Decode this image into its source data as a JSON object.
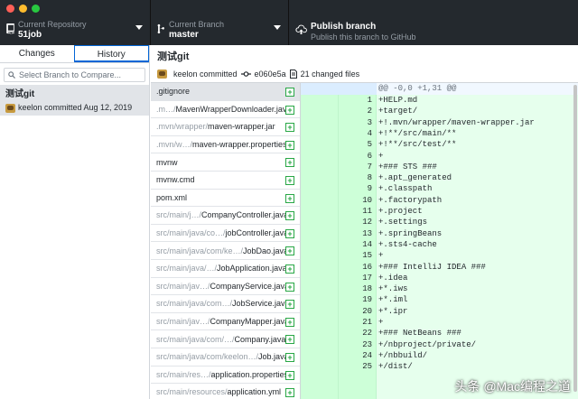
{
  "toolbar": {
    "repo_label": "Current Repository",
    "repo_value": "51job",
    "branch_label": "Current Branch",
    "branch_value": "master",
    "publish_title": "Publish branch",
    "publish_subtitle": "Publish this branch to GitHub"
  },
  "sidebar": {
    "tabs": [
      {
        "label": "Changes"
      },
      {
        "label": "History"
      }
    ],
    "active_tab": "History",
    "filter_placeholder": "Select Branch to Compare...",
    "commit": {
      "title": "测试git",
      "meta": "keelon committed Aug 12, 2019"
    }
  },
  "commit_header": {
    "title": "测试git",
    "author": "keelon committed",
    "sha": "e060e5a",
    "changed": "21 changed files"
  },
  "files": [
    {
      "dir": "",
      "name": ".gitignore"
    },
    {
      "dir": ".m…/",
      "name": "MavenWrapperDownloader.java"
    },
    {
      "dir": ".mvn/wrapper/",
      "name": "maven-wrapper.jar"
    },
    {
      "dir": ".mvn/w…/",
      "name": "maven-wrapper.properties"
    },
    {
      "dir": "",
      "name": "mvnw"
    },
    {
      "dir": "",
      "name": "mvnw.cmd"
    },
    {
      "dir": "",
      "name": "pom.xml"
    },
    {
      "dir": "src/main/j…/",
      "name": "CompanyController.java"
    },
    {
      "dir": "src/main/java/co…/",
      "name": "jobController.java"
    },
    {
      "dir": "src/main/java/com/ke…/",
      "name": "JobDao.java"
    },
    {
      "dir": "src/main/java/…/",
      "name": "JobApplication.java"
    },
    {
      "dir": "src/main/jav…/",
      "name": "CompanyService.java"
    },
    {
      "dir": "src/main/java/com…/",
      "name": "JobService.java"
    },
    {
      "dir": "src/main/jav…/",
      "name": "CompanyMapper.java"
    },
    {
      "dir": "src/main/java/com/…/",
      "name": "Company.java"
    },
    {
      "dir": "src/main/java/com/keelon…/",
      "name": "Job.java"
    },
    {
      "dir": "src/main/res…/",
      "name": "application.properties"
    },
    {
      "dir": "src/main/resources/",
      "name": "application.yml"
    }
  ],
  "diff": {
    "hunk": "@@ -0,0 +1,31 @@",
    "lines": [
      {
        "n": "1",
        "text": "+HELP.md"
      },
      {
        "n": "2",
        "text": "+target/"
      },
      {
        "n": "3",
        "text": "+!.mvn/wrapper/maven-wrapper.jar"
      },
      {
        "n": "4",
        "text": "+!**/src/main/**"
      },
      {
        "n": "5",
        "text": "+!**/src/test/**"
      },
      {
        "n": "6",
        "text": "+"
      },
      {
        "n": "7",
        "text": "+### STS ###"
      },
      {
        "n": "8",
        "text": "+.apt_generated"
      },
      {
        "n": "9",
        "text": "+.classpath"
      },
      {
        "n": "10",
        "text": "+.factorypath"
      },
      {
        "n": "11",
        "text": "+.project"
      },
      {
        "n": "12",
        "text": "+.settings"
      },
      {
        "n": "13",
        "text": "+.springBeans"
      },
      {
        "n": "14",
        "text": "+.sts4-cache"
      },
      {
        "n": "15",
        "text": "+"
      },
      {
        "n": "16",
        "text": "+### IntelliJ IDEA ###"
      },
      {
        "n": "17",
        "text": "+.idea"
      },
      {
        "n": "18",
        "text": "+*.iws"
      },
      {
        "n": "19",
        "text": "+*.iml"
      },
      {
        "n": "20",
        "text": "+*.ipr"
      },
      {
        "n": "21",
        "text": "+"
      },
      {
        "n": "22",
        "text": "+### NetBeans ###"
      },
      {
        "n": "23",
        "text": "+/nbproject/private/"
      },
      {
        "n": "24",
        "text": "+/nbbuild/"
      },
      {
        "n": "25",
        "text": "+/dist/"
      }
    ]
  },
  "watermark": "头条 @Mac编程之道",
  "colors": {
    "toolbar": "#24292e",
    "accent": "#0366d6",
    "added": "#28a745",
    "diff_bg": "#e6ffed"
  }
}
